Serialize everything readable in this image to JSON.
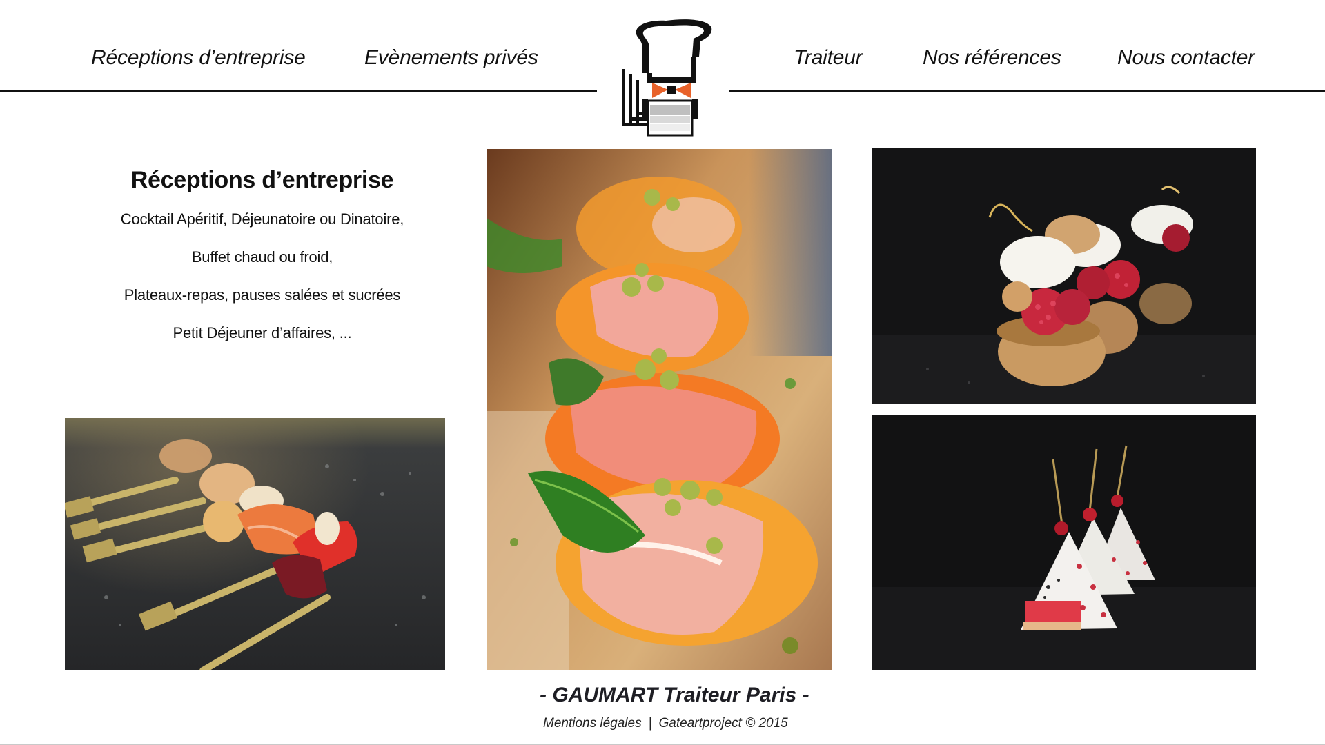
{
  "nav": {
    "items": [
      {
        "label": "Réceptions d’entreprise"
      },
      {
        "label": "Evènements privés"
      },
      {
        "label": "Traiteur"
      },
      {
        "label": "Nos références"
      },
      {
        "label": "Nous contacter"
      }
    ]
  },
  "logo": {
    "icon": "chef-hat-logo-icon",
    "accent_color": "#e8622a"
  },
  "intro": {
    "title": "Réceptions d’entreprise",
    "lines": [
      "Cocktail Apéritif, Déjeunatoire ou Dinatoire,",
      "Buffet chaud ou froid,",
      "Plateaux-repas, pauses salées et sucrées",
      "Petit Déjeuner d’affaires, ..."
    ]
  },
  "photos": {
    "skewers": "skewers-photo",
    "prosciutto": "prosciutto-peach-photo",
    "choux": "raspberry-choux-photo",
    "petit_fours": "petit-fours-photo"
  },
  "footer": {
    "title": "- GAUMART Traiteur Paris -",
    "legal_label": "Mentions légales",
    "separator": "|",
    "credit": "Gateartproject © 2015"
  }
}
